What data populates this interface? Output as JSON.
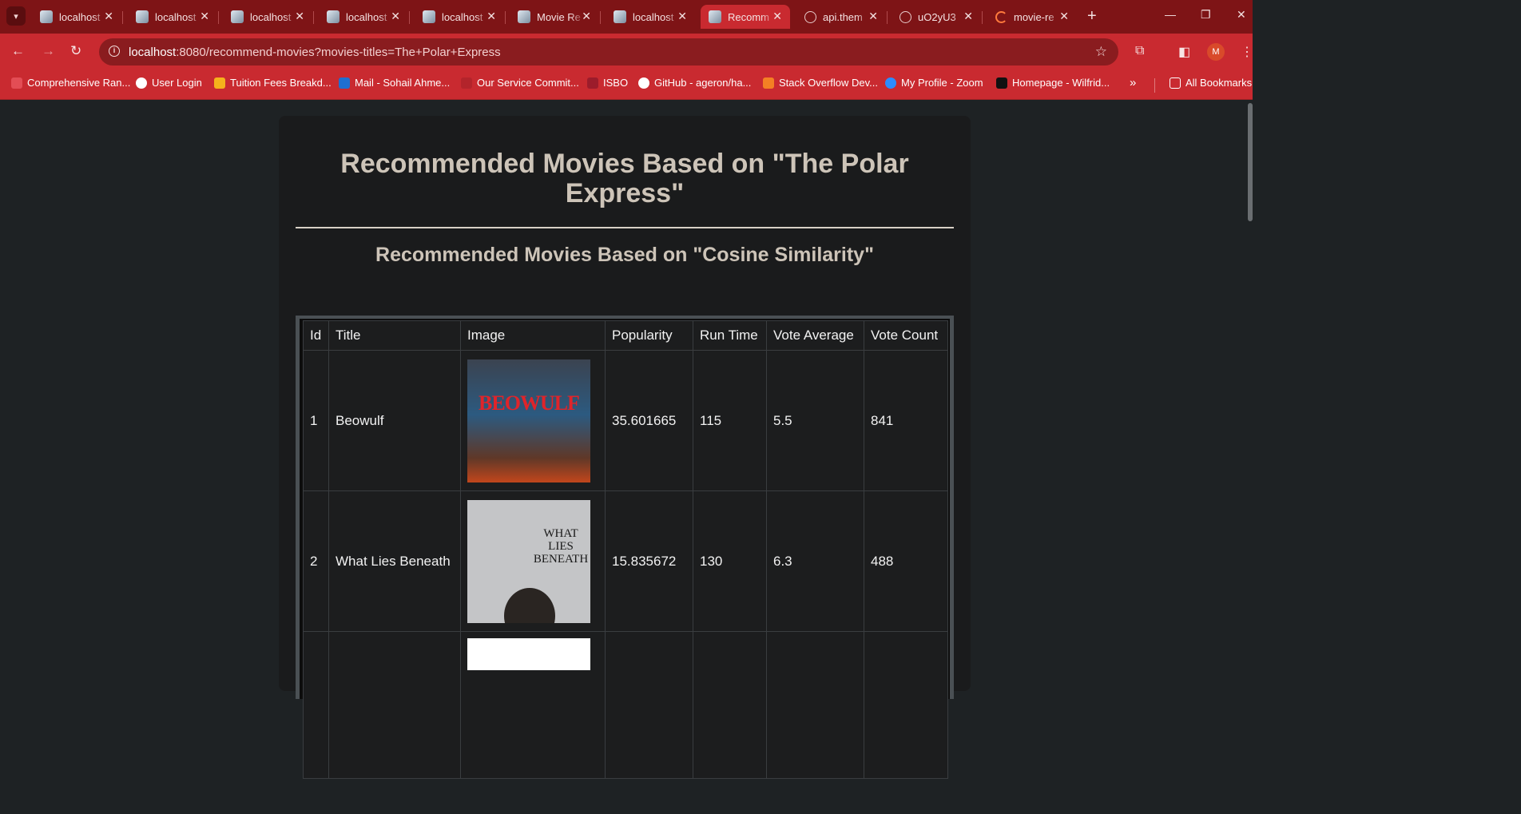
{
  "tabs": [
    {
      "title": "localhost",
      "icon": "app-icon"
    },
    {
      "title": "localhost",
      "icon": "app-icon"
    },
    {
      "title": "localhost",
      "icon": "app-icon"
    },
    {
      "title": "localhost",
      "icon": "app-icon"
    },
    {
      "title": "localhost",
      "icon": "app-icon"
    },
    {
      "title": "Movie Re",
      "icon": "app-icon"
    },
    {
      "title": "localhost",
      "icon": "app-icon"
    },
    {
      "title": "Recomm",
      "icon": "app-icon"
    },
    {
      "title": "api.them",
      "icon": "globe-icon"
    },
    {
      "title": "uO2yU3",
      "icon": "globe-icon"
    },
    {
      "title": "movie-re",
      "icon": "loading-icon"
    }
  ],
  "address": {
    "host": "localhost",
    "rest": ":8080/recommend-movies?movies-titles=The+Polar+Express"
  },
  "bookmarks": [
    "Comprehensive Ran...",
    "User Login",
    "Tuition Fees Breakd...",
    "Mail - Sohail Ahme...",
    "Our Service Commit...",
    "ISBO",
    "GitHub - ageron/ha...",
    "Stack Overflow Dev...",
    "My Profile - Zoom",
    "Homepage - Wilfrid..."
  ],
  "all_bookmarks": "All Bookmarks",
  "profile_initial": "M",
  "page": {
    "title": "Recommended Movies Based on \"The Polar Express\"",
    "subtitle": "Recommended Movies Based on \"Cosine Similarity\""
  },
  "table": {
    "headers": [
      "Id",
      "Title",
      "Image",
      "Popularity",
      "Run Time",
      "Vote Average",
      "Vote Count"
    ],
    "rows": [
      {
        "id": "1",
        "title": "Beowulf",
        "poster": "BEOWULF",
        "popularity": "35.601665",
        "runtime": "115",
        "vote_average": "5.5",
        "vote_count": "841"
      },
      {
        "id": "2",
        "title": "What Lies Beneath",
        "poster": "WHAT LIES BENEATH",
        "popularity": "15.835672",
        "runtime": "130",
        "vote_average": "6.3",
        "vote_count": "488"
      }
    ]
  },
  "colors": {
    "tab_strip": "#7e1416",
    "toolbar": "#c92a30",
    "page_bg": "#1e2224",
    "card_bg": "#1a1b1c",
    "heading": "#cdc4b8"
  }
}
